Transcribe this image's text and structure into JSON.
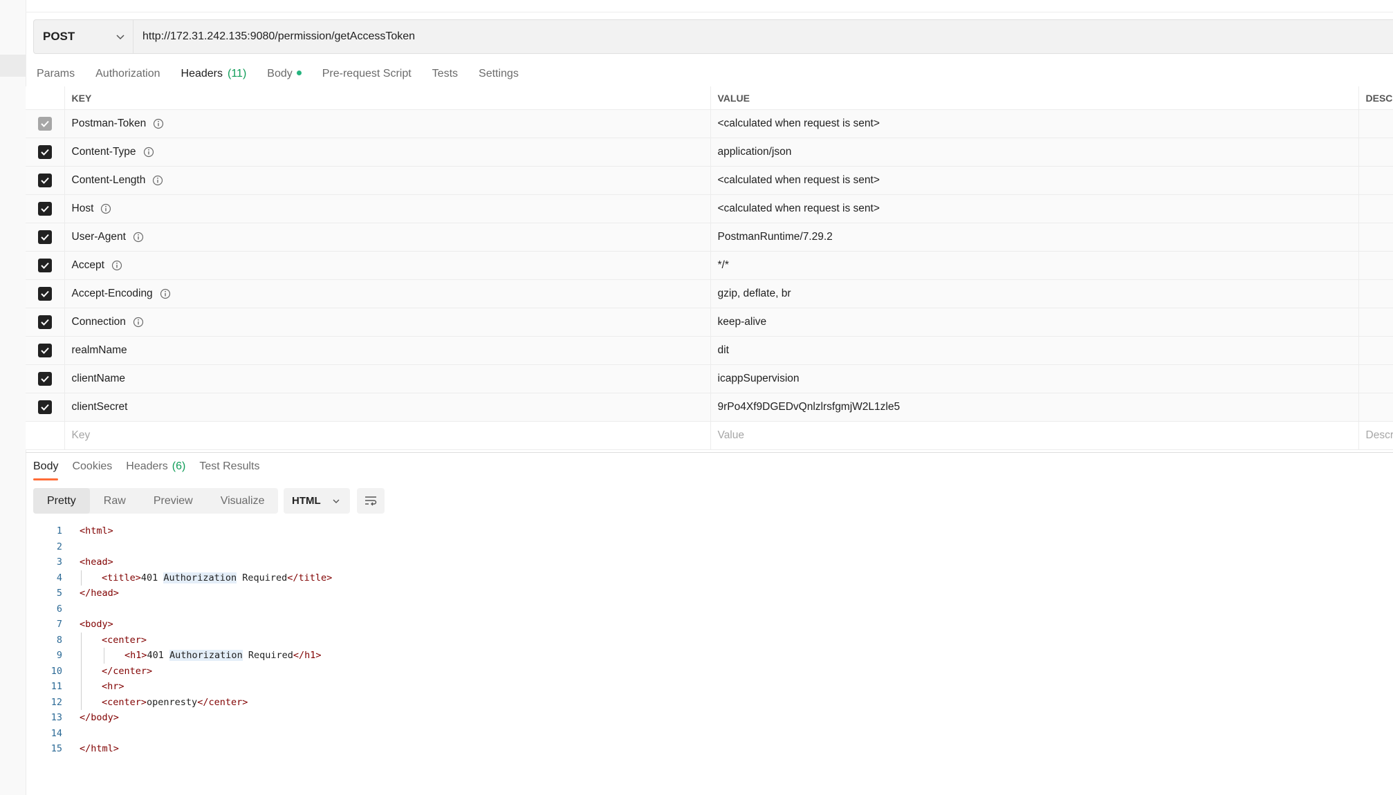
{
  "request": {
    "method": "POST",
    "url": "http://172.31.242.135:9080/permission/getAccessToken"
  },
  "request_tabs": [
    {
      "label": "Params"
    },
    {
      "label": "Authorization"
    },
    {
      "label": "Headers",
      "count": "(11)"
    },
    {
      "label": "Body"
    },
    {
      "label": "Pre-request Script"
    },
    {
      "label": "Tests"
    },
    {
      "label": "Settings"
    }
  ],
  "headers_table": {
    "columns": [
      "KEY",
      "VALUE",
      "DESC"
    ],
    "rows": [
      {
        "key": "Postman-Token",
        "value": "<calculated when request is sent>"
      },
      {
        "key": "Content-Type",
        "value": "application/json"
      },
      {
        "key": "Content-Length",
        "value": "<calculated when request is sent>"
      },
      {
        "key": "Host",
        "value": "<calculated when request is sent>"
      },
      {
        "key": "User-Agent",
        "value": "PostmanRuntime/7.29.2"
      },
      {
        "key": "Accept",
        "value": "*/*"
      },
      {
        "key": "Accept-Encoding",
        "value": "gzip, deflate, br"
      },
      {
        "key": "Connection",
        "value": "keep-alive"
      },
      {
        "key": "realmName",
        "value": "dit"
      },
      {
        "key": "clientName",
        "value": "icappSupervision"
      },
      {
        "key": "clientSecret",
        "value": "9rPo4Xf9DGEDvQnlzlrsfgmjW2L1zle5"
      }
    ],
    "placeholders": {
      "key": "Key",
      "value": "Value",
      "description": "Descr"
    }
  },
  "response_tabs": [
    {
      "label": "Body"
    },
    {
      "label": "Cookies"
    },
    {
      "label": "Headers",
      "count": "(6)"
    },
    {
      "label": "Test Results"
    }
  ],
  "view_modes": [
    "Pretty",
    "Raw",
    "Preview",
    "Visualize"
  ],
  "language": "HTML",
  "code_lines": [
    "1",
    "2",
    "3",
    "4",
    "5",
    "6",
    "7",
    "8",
    "9",
    "10",
    "11",
    "12",
    "13",
    "14",
    "15"
  ],
  "code": {
    "html_open": "<html>",
    "head_open": "<head>",
    "title_open": "<title>",
    "title_num": "401 ",
    "title_word": "Authorization",
    "title_rest": " Required",
    "title_close": "</title>",
    "head_close": "</head>",
    "body_open": "<body>",
    "center_open": "<center>",
    "h1_open": "<h1>",
    "h1_num": "401 ",
    "h1_word": "Authorization",
    "h1_rest": " Required",
    "h1_close": "</h1>",
    "center_close": "</center>",
    "hr": "<hr>",
    "center_text": "openresty",
    "body_close": "</body>",
    "html_close": "</html>"
  },
  "colors": {
    "accent": "#ff6c37",
    "count_green": "#0f9d58",
    "tag": "#800000",
    "line_number": "#2c6a96"
  }
}
